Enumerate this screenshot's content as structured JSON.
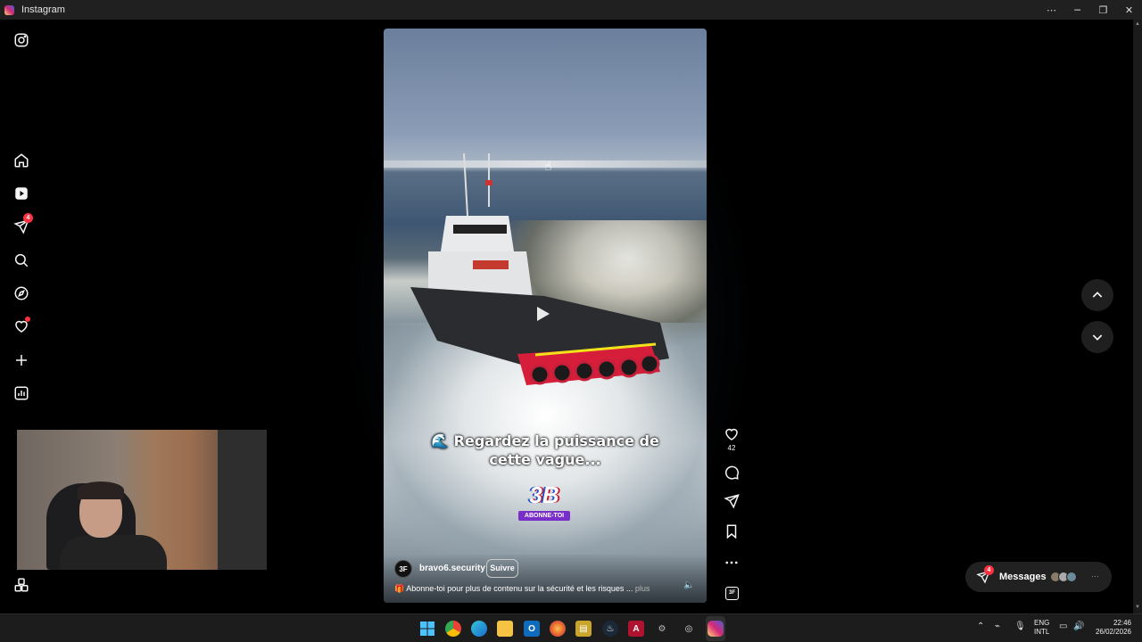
{
  "window": {
    "title": "Instagram"
  },
  "sidebar": {
    "items": [
      {
        "name": "instagram-logo-icon"
      },
      {
        "name": "home-icon",
        "label": "Home"
      },
      {
        "name": "reels-icon",
        "label": "Reels"
      },
      {
        "name": "messages-icon",
        "label": "Messages",
        "badge": "4"
      },
      {
        "name": "search-icon",
        "label": "Search"
      },
      {
        "name": "explore-icon",
        "label": "Explore"
      },
      {
        "name": "notifications-icon",
        "label": "Notifications"
      },
      {
        "name": "create-icon",
        "label": "Create"
      },
      {
        "name": "dashboard-icon",
        "label": "Dashboard"
      },
      {
        "name": "more-icon",
        "label": "More"
      }
    ]
  },
  "reel": {
    "caption_line1": "🌊 Regardez la puissance de",
    "caption_line2": "cette vague...",
    "overlay_logo": "3B",
    "overlay_badge": "ABONNE-TOI",
    "author": "bravo6.security",
    "author_initials": "3F",
    "follow_label": "Suivre",
    "description": "🎁 Abonne-toi pour plus de contenu sur la sécurité et les risques ...",
    "more_label": "plus",
    "likes": "42"
  },
  "messages_pill": {
    "label": "Messages",
    "badge": "4"
  },
  "taskbar": {
    "lang_line1": "ENG",
    "lang_line2": "INTL",
    "time": "22:46",
    "date": "26/02/2026"
  },
  "colors": {
    "badge": "#ff3040",
    "background": "#000000",
    "surface": "#212121",
    "abonne_badge": "#7a2ec9"
  }
}
